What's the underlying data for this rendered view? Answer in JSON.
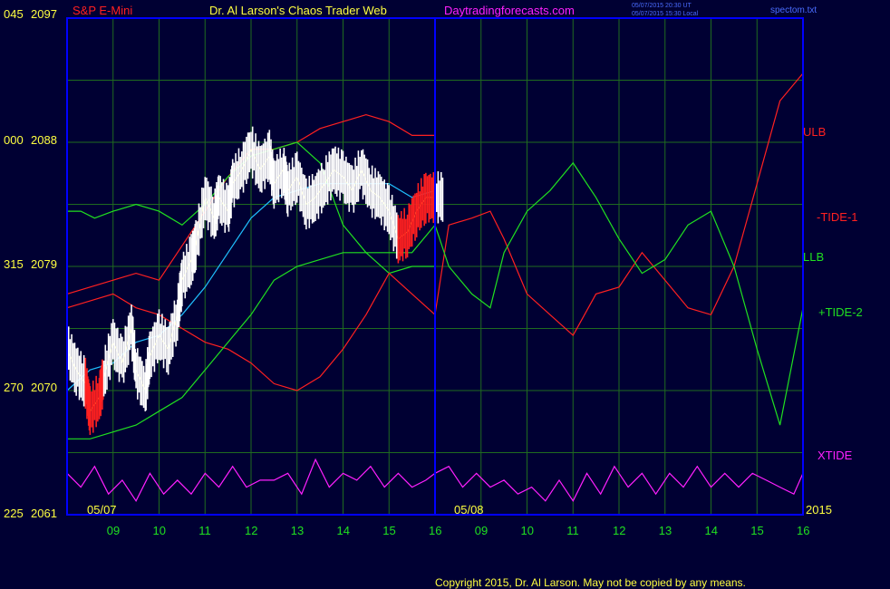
{
  "header": {
    "instrument": "S&P E-Mini",
    "title": "Dr. Al Larson's Chaos Trader Web",
    "site": "Daytradingforecasts.com",
    "stamp_utc": "05/07/2015 20:30 UT",
    "stamp_local": "05/07/2015 15:30 Local",
    "file": "spectom.txt"
  },
  "footer": {
    "copyright": "Copyright 2015, Dr. Al Larson. May not be copied by any means."
  },
  "colors": {
    "background": "#000033",
    "frame": "#0000ff",
    "grid": "#1f6b1f",
    "red": "#ff2020",
    "green": "#20e020",
    "cyan": "#20c0ff",
    "magenta": "#ff20ff",
    "yellow": "#ffff40",
    "price_bars": "#ffffff"
  },
  "chart_data": {
    "type": "line",
    "title": "S&P E-Mini",
    "ylim": [
      2061,
      2097
    ],
    "y_ticks": [
      {
        "left": "045",
        "value": "2097"
      },
      {
        "left": "000",
        "value": "2088"
      },
      {
        "left": "315",
        "value": "2079"
      },
      {
        "left": "270",
        "value": "2070"
      },
      {
        "left": "225",
        "value": "2061"
      }
    ],
    "x_tick_labels": [
      "09",
      "10",
      "11",
      "12",
      "13",
      "14",
      "15",
      "16",
      "09",
      "10",
      "11",
      "12",
      "13",
      "14",
      "15",
      "16"
    ],
    "xlim": [
      8.0,
      24.0
    ],
    "date_labels": [
      {
        "text": "05/07",
        "x": 8.5
      },
      {
        "text": "05/08",
        "x": 16.5
      }
    ],
    "year_label": "2015",
    "divider_x": 16.0,
    "series_labels": [
      "ULB",
      "-TIDE-1",
      "LLB",
      "+TIDE-2",
      "XTIDE"
    ],
    "series": [
      {
        "name": "Price (E-mini bars, 05/07)",
        "color": "#ffffff",
        "x": [
          8.0,
          8.2,
          8.4,
          8.5,
          8.7,
          8.8,
          9.0,
          9.2,
          9.4,
          9.5,
          9.7,
          9.8,
          10.0,
          10.2,
          10.4,
          10.5,
          10.7,
          10.8,
          11.0,
          11.2,
          11.3,
          11.5,
          11.6,
          11.8,
          12.0,
          12.2,
          12.4,
          12.5,
          12.7,
          12.8,
          13.0,
          13.2,
          13.4,
          13.6,
          13.8,
          14.0,
          14.2,
          14.4,
          14.6,
          14.8,
          15.0,
          15.2,
          15.4,
          15.6,
          15.8,
          16.0
        ],
        "y": [
          2073.0,
          2071.5,
          2070.5,
          2068.5,
          2069.5,
          2071.0,
          2073.5,
          2072.0,
          2074.5,
          2071.5,
          2070.0,
          2072.5,
          2074.0,
          2073.0,
          2075.5,
          2078.0,
          2079.5,
          2080.5,
          2084.0,
          2082.5,
          2084.0,
          2083.0,
          2085.0,
          2086.0,
          2087.5,
          2086.0,
          2087.0,
          2085.0,
          2086.0,
          2084.5,
          2085.5,
          2083.5,
          2084.0,
          2085.0,
          2086.0,
          2085.5,
          2084.5,
          2086.0,
          2084.5,
          2084.0,
          2083.0,
          2081.0,
          2081.5,
          2083.0,
          2084.0,
          2084.0
        ]
      },
      {
        "name": "Cyan moving average",
        "color": "#20c0ff",
        "x": [
          8.0,
          8.5,
          9.0,
          9.5,
          10.0,
          10.5,
          11.0,
          11.5,
          12.0,
          12.5,
          13.0,
          13.5,
          14.0,
          14.5,
          15.0,
          15.5,
          16.0
        ],
        "y": [
          2070.0,
          2071.5,
          2072.0,
          2073.5,
          2074.0,
          2075.5,
          2077.5,
          2080.0,
          2082.5,
          2084.0,
          2084.5,
          2085.0,
          2085.0,
          2085.0,
          2085.0,
          2084.0,
          2084.5
        ]
      },
      {
        "name": "ULB (05/07)",
        "color": "#ff2020",
        "x": [
          8.0,
          8.5,
          9.0,
          9.5,
          10.0,
          10.5,
          11.0,
          11.5,
          12.0,
          12.5,
          13.0,
          13.5,
          14.0,
          14.5,
          15.0,
          15.5,
          16.0
        ],
        "y": [
          2077.0,
          2077.5,
          2078.0,
          2078.5,
          2078.0,
          2080.5,
          2083.0,
          2085.5,
          2087.5,
          2087.5,
          2088.0,
          2089.0,
          2089.5,
          2090.0,
          2089.5,
          2088.5,
          2088.5
        ]
      },
      {
        "name": "LLB (05/07)",
        "color": "#20e020",
        "x": [
          8.0,
          8.3,
          8.6,
          9.0,
          9.5,
          10.0,
          10.5,
          11.0,
          11.5,
          12.0,
          12.5,
          13.0,
          13.5,
          14.0,
          14.5,
          15.0,
          15.5,
          16.0
        ],
        "y": [
          2083.0,
          2083.0,
          2082.5,
          2083.0,
          2083.5,
          2083.0,
          2082.0,
          2083.5,
          2085.5,
          2087.0,
          2087.5,
          2088.0,
          2086.5,
          2082.0,
          2080.0,
          2078.5,
          2079.0,
          2079.0
        ]
      },
      {
        "name": "-TIDE-1",
        "color": "#ff2020",
        "x": [
          8.0,
          8.5,
          9.0,
          9.5,
          10.0,
          10.5,
          11.0,
          11.5,
          12.0,
          12.5,
          13.0,
          13.5,
          14.0,
          14.5,
          15.0,
          15.5,
          16.0,
          16.3,
          16.8,
          17.2,
          17.5,
          18.0,
          18.5,
          19.0,
          19.5,
          20.0,
          20.5,
          21.0,
          21.5,
          22.0,
          22.5,
          23.0,
          23.5,
          24.0
        ],
        "y": [
          2076.0,
          2076.5,
          2077.0,
          2076.0,
          2075.5,
          2074.5,
          2073.5,
          2073.0,
          2072.0,
          2070.5,
          2070.0,
          2071.0,
          2073.0,
          2075.5,
          2078.5,
          2077.0,
          2075.5,
          2082.0,
          2082.5,
          2083.0,
          2081.0,
          2077.0,
          2075.5,
          2074.0,
          2077.0,
          2077.5,
          2080.0,
          2078.0,
          2076.0,
          2075.5,
          2079.0,
          2085.0,
          2091.0,
          2093.0
        ]
      },
      {
        "name": "+TIDE-2",
        "color": "#20e020",
        "x": [
          8.0,
          8.5,
          9.0,
          9.5,
          10.0,
          10.5,
          11.0,
          11.5,
          12.0,
          12.5,
          13.0,
          13.5,
          14.0,
          14.5,
          15.0,
          15.5,
          16.0,
          16.3,
          16.8,
          17.2,
          17.5,
          18.0,
          18.5,
          19.0,
          19.5,
          20.0,
          20.5,
          21.0,
          21.5,
          22.0,
          22.5,
          23.0,
          23.5,
          24.0
        ],
        "y": [
          2066.5,
          2066.5,
          2067.0,
          2067.5,
          2068.5,
          2069.5,
          2071.5,
          2073.5,
          2075.5,
          2078.0,
          2079.0,
          2079.5,
          2080.0,
          2080.0,
          2080.0,
          2080.0,
          2082.0,
          2079.0,
          2077.0,
          2076.0,
          2080.0,
          2083.0,
          2084.5,
          2086.5,
          2084.0,
          2081.0,
          2078.5,
          2079.5,
          2082.0,
          2083.0,
          2079.0,
          2073.0,
          2067.5,
          2076.0
        ]
      },
      {
        "name": "XTIDE",
        "color": "#ff20ff",
        "x": [
          8.0,
          8.3,
          8.6,
          8.9,
          9.2,
          9.5,
          9.8,
          10.1,
          10.4,
          10.7,
          11.0,
          11.3,
          11.6,
          11.9,
          12.2,
          12.5,
          12.8,
          13.1,
          13.4,
          13.7,
          14.0,
          14.3,
          14.6,
          14.9,
          15.2,
          15.5,
          15.8,
          16.0,
          16.3,
          16.6,
          16.9,
          17.2,
          17.5,
          17.8,
          18.1,
          18.4,
          18.7,
          19.0,
          19.3,
          19.6,
          19.9,
          20.2,
          20.5,
          20.8,
          21.1,
          21.4,
          21.7,
          22.0,
          22.3,
          22.6,
          22.9,
          23.2,
          23.5,
          23.8,
          24.0
        ],
        "y": [
          2064.0,
          2063.0,
          2064.5,
          2062.5,
          2063.5,
          2062.0,
          2064.0,
          2062.5,
          2063.5,
          2062.5,
          2064.0,
          2063.0,
          2064.5,
          2063.0,
          2063.5,
          2063.5,
          2064.0,
          2062.5,
          2065.0,
          2063.0,
          2064.0,
          2063.5,
          2064.5,
          2063.0,
          2064.0,
          2063.0,
          2063.5,
          2064.0,
          2064.5,
          2063.0,
          2064.0,
          2063.0,
          2063.5,
          2062.5,
          2063.0,
          2062.0,
          2063.5,
          2062.0,
          2064.0,
          2062.5,
          2064.5,
          2063.0,
          2064.0,
          2062.5,
          2064.0,
          2063.0,
          2064.5,
          2063.0,
          2064.0,
          2063.0,
          2064.0,
          2063.5,
          2063.0,
          2062.5,
          2064.0
        ]
      }
    ]
  }
}
